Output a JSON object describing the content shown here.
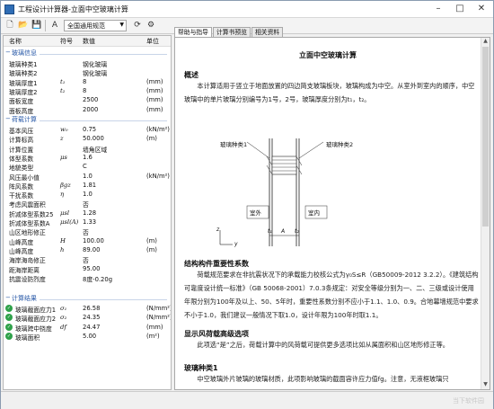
{
  "window": {
    "title": "工程设计计算器-立面中空玻璃计算",
    "minimize": "–",
    "maximize": "□",
    "close": "✕"
  },
  "toolbar": {
    "spec_select": "全国通用规范"
  },
  "params": {
    "headers": {
      "name": "名称",
      "symbol": "符号",
      "value": "数值",
      "unit": "单位"
    },
    "sections": [
      {
        "label": "玻璃信息"
      },
      {
        "label": "荷载计算"
      },
      {
        "label": "计算结果"
      }
    ],
    "glass": [
      {
        "name": "玻璃种类1",
        "sym": "",
        "val": "钢化玻璃",
        "unit": ""
      },
      {
        "name": "玻璃种类2",
        "sym": "",
        "val": "钢化玻璃",
        "unit": ""
      },
      {
        "name": "玻璃厚度1",
        "sym": "t₁",
        "val": "8",
        "unit": "(mm)"
      },
      {
        "name": "玻璃厚度2",
        "sym": "t₂",
        "val": "8",
        "unit": "(mm)"
      },
      {
        "name": "面板宽度",
        "sym": "",
        "val": "2500",
        "unit": "(mm)"
      },
      {
        "name": "面板高度",
        "sym": "",
        "val": "2000",
        "unit": "(mm)"
      }
    ],
    "load": [
      {
        "name": "基本风压",
        "sym": "w₀",
        "val": "0.75",
        "unit": "(kN/m²)"
      },
      {
        "name": "计算标高",
        "sym": "z",
        "val": "50.000",
        "unit": "(m)"
      },
      {
        "name": "计算位置",
        "sym": "",
        "val": "墙角区域",
        "unit": ""
      },
      {
        "name": "体型系数",
        "sym": "μs",
        "val": "1.6",
        "unit": ""
      },
      {
        "name": "地貌类型",
        "sym": "",
        "val": "C",
        "unit": ""
      },
      {
        "name": "风压最小值",
        "sym": "",
        "val": "1.0",
        "unit": "(kN/m²)"
      },
      {
        "name": "阵风系数",
        "sym": "βgz",
        "val": "1.81",
        "unit": ""
      },
      {
        "name": "干扰系数",
        "sym": "η",
        "val": "1.0",
        "unit": ""
      },
      {
        "name": "考虑风震面积",
        "sym": "",
        "val": "否",
        "unit": ""
      },
      {
        "name": "折减体型系数25",
        "sym": "μsl",
        "val": "1.28",
        "unit": ""
      },
      {
        "name": "折减体型系数A",
        "sym": "μsl(A)",
        "val": "1.33",
        "unit": ""
      },
      {
        "name": "山区地形修正",
        "sym": "",
        "val": "否",
        "unit": ""
      },
      {
        "name": "山峰高度",
        "sym": "H",
        "val": "100.00",
        "unit": "(m)"
      },
      {
        "name": "山峰高度",
        "sym": "h",
        "val": "89.00",
        "unit": "(m)"
      },
      {
        "name": "海岸海岛修正",
        "sym": "",
        "val": "否",
        "unit": ""
      },
      {
        "name": "距海岸距离",
        "sym": "",
        "val": "95.00",
        "unit": ""
      },
      {
        "name": "抗震设防烈度",
        "sym": "",
        "val": "8度-0.20g",
        "unit": ""
      }
    ],
    "results": [
      {
        "name": "玻璃截面应力1",
        "sym": "σ₁",
        "val": "26.58",
        "unit": "(N/mm²)"
      },
      {
        "name": "玻璃截面应力2",
        "sym": "σ₂",
        "val": "24.35",
        "unit": "(N/mm²)"
      },
      {
        "name": "玻璃跨中挠度",
        "sym": "df",
        "val": "24.47",
        "unit": "(mm)"
      },
      {
        "name": "玻璃面积",
        "sym": "",
        "val": "5.00",
        "unit": "(m²)"
      }
    ]
  },
  "tabs": [
    "帮助与指导",
    "计算书预览",
    "相关资料"
  ],
  "doc": {
    "title": "立面中空玻璃计算",
    "h_overview": "概述",
    "p_overview": "本计算适用于竖立于地面放置的四边简支玻璃板块，玻璃构成为中空。从室外到室内的顺序，中空玻璃中的单片玻璃分别编号为1号，2号，玻璃厚度分别为t₁，t₂。",
    "fig_label1": "玻璃种类1",
    "fig_label2": "玻璃种类2",
    "fig_outside": "室外",
    "fig_inside": "室内",
    "fig_t1": "t₁",
    "fig_a": "A",
    "fig_t2": "t₂",
    "fig_z": "z",
    "fig_y": "y",
    "h_importance": "结构构件重要性系数",
    "p_importance": "荷载规范要求在非抗震状况下的承载能力校核公式为γ₀S≤R（GB50009-2012 3.2.2）。《建筑结构可靠度设计统一标准》（GB 50068-2001）7.0.3条规定：对安全等级分别为一、二、三级或设计使用年限分别为100年及以上、50、5年时，重要性系数分别不应小于1.1、1.0、0.9。合地幕墙规范中要求不小于1.0，我们建议一般情况下取1.0，设计年限为100年时取1.1。",
    "h_show": "显示风荷载高级选项",
    "p_show": "此项选“是”之后，荷载计算中的风荷载可提供更多选项比如从属面积和山区地形修正等。",
    "h_glass": "玻璃种类1",
    "p_glass": "中空玻璃外片玻璃的玻璃材质，此项影响玻璃的截面容许应力值fg。注意，无液框玻璃只"
  },
  "watermark": "当下软件园"
}
